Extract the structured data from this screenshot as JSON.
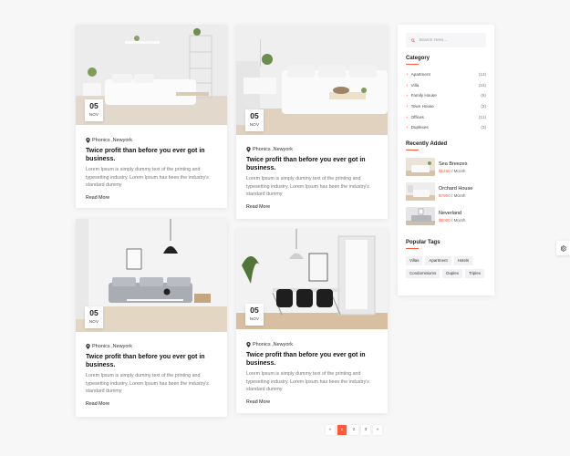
{
  "posts": [
    {
      "date_day": "05",
      "date_month": "NOV",
      "location": "Phonics ,Newyork",
      "title": "Twice profit than before you ever got in business.",
      "excerpt": "Lorem Ipsum is simply dummy text of the printing and typesetting industry. Lorem Ipsum has been the industry's standard dummy",
      "read_more": "Read More"
    },
    {
      "date_day": "05",
      "date_month": "NOV",
      "location": "Phonics ,Newyork",
      "title": "Twice profit than before you ever got in business.",
      "excerpt": "Lorem Ipsum is simply dummy text of the printing and typesetting industry. Lorem Ipsum has been the industry's standard dummy",
      "read_more": "Read More"
    },
    {
      "date_day": "05",
      "date_month": "NOV",
      "location": "Phonics ,Newyork",
      "title": "Twice profit than before you ever got in business.",
      "excerpt": "Lorem Ipsum is simply dummy text of the printing and typesetting industry. Lorem Ipsum has been the industry's standard dummy",
      "read_more": "Read More"
    },
    {
      "date_day": "05",
      "date_month": "NOV",
      "location": "Phonics ,Newyork",
      "title": "Twice profit than before you ever got in business.",
      "excerpt": "Lorem Ipsum is simply dummy text of the printing and typesetting industry. Lorem Ipsum has been the industry's standard dummy",
      "read_more": "Read More"
    }
  ],
  "sidebar": {
    "search_placeholder": "Search Here...",
    "category_heading": "Category",
    "categories": [
      {
        "name": "Apartment",
        "count": "(13)"
      },
      {
        "name": "Villa",
        "count": "(16)"
      },
      {
        "name": "Family House",
        "count": "(8)"
      },
      {
        "name": "Town House",
        "count": "(3)"
      },
      {
        "name": "Offices",
        "count": "(12)"
      },
      {
        "name": "Duplexes",
        "count": "(3)"
      }
    ],
    "recent_heading": "Recently Added",
    "recent": [
      {
        "name": "Sea Breezes",
        "price": "$1460",
        "period": " / Month"
      },
      {
        "name": "Orchard House",
        "price": "$7900",
        "period": " / Month"
      },
      {
        "name": "Neverland",
        "price": "$5000",
        "period": " / Month"
      }
    ],
    "tags_heading": "Popular Tags",
    "tags": [
      "Villas",
      "Apartment",
      "Hotels",
      "Condominiums",
      "Duplex",
      "Triplex"
    ]
  },
  "pagination": {
    "prev": "«",
    "pages": [
      "1",
      "2",
      "3"
    ],
    "next": "»",
    "active_page": "1"
  },
  "colors": {
    "accent": "#ff5a3c"
  },
  "icons": {
    "location": "map-pin-icon",
    "search": "search-icon",
    "settings": "gear-icon",
    "category_bullet": "plus-icon"
  }
}
